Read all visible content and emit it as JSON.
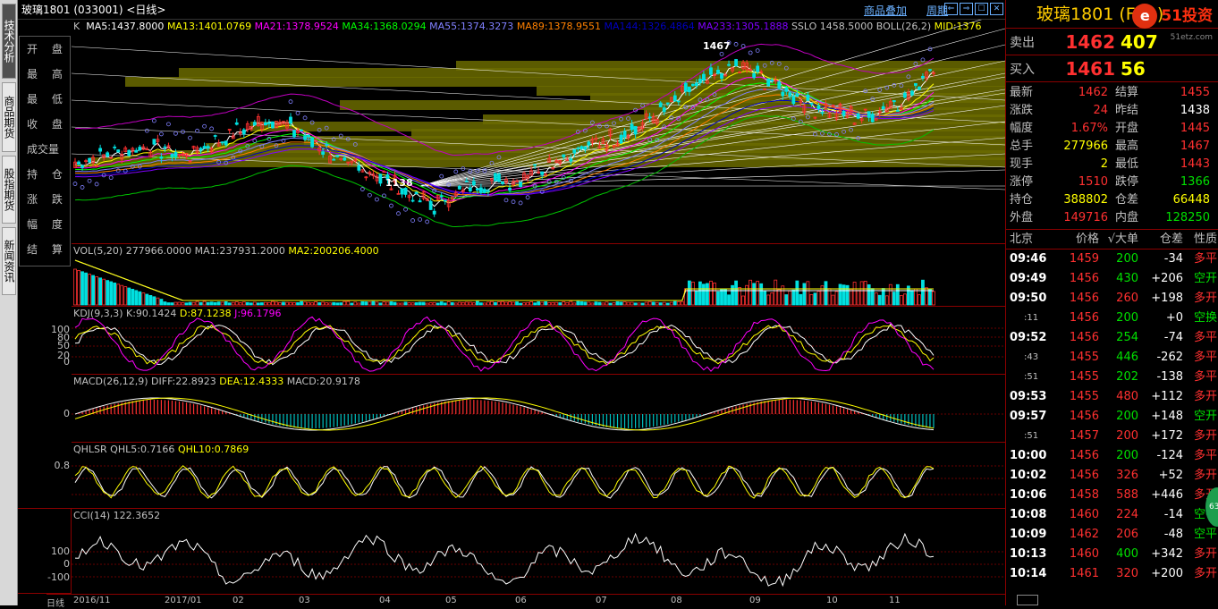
{
  "window": {
    "title": "玻璃1801 (033001) <日线>",
    "link1": "商品叠加",
    "link2": "周期",
    "nav1": "⇐",
    "nav2": "⇒",
    "nav3": "☐",
    "nav4": "✕"
  },
  "lefttabs": [
    "技术分析",
    "商品期货",
    "股指期货",
    "新闻资讯"
  ],
  "infopanel": [
    "开 盘",
    "最 高",
    "最 低",
    "收 盘",
    "成交量",
    "持 仓",
    "涨 跌",
    "幅 度",
    "结 算"
  ],
  "kpanel": {
    "label_k": "K",
    "ma5": "MA5:1437.8000",
    "ma13": "MA13:1401.0769",
    "ma21": "MA21:1378.9524",
    "ma34": "MA34:1368.0294",
    "ma55": "MA55:1374.3273",
    "ma89": "MA89:1378.9551",
    "ma144": "MA144:1326.4864",
    "ma233": "MA233:1305.1888",
    "sslo": "SSLO 1458.5000",
    "boll": "BOLL(26,2)",
    "mid": "MID:1376",
    "high_mark": "1467",
    "low_mark": "1138"
  },
  "volpanel": {
    "label": "VOL(5,20) 277966.0000",
    "ma1": "MA1:237931.2000",
    "ma2": "MA2:200206.4000"
  },
  "kdjpanel": {
    "label": "KDJ(9,3,3) K:90.1424",
    "d": "D:87.1238",
    "j": "J:96.1796",
    "ticks": [
      "100",
      "80",
      "50",
      "20",
      "0"
    ]
  },
  "macdpanel": {
    "label": "MACD(26,12,9) DIFF:22.8923",
    "dea": "DEA:12.4333",
    "macd": "MACD:20.9178",
    "tick": "0"
  },
  "qhlpanel": {
    "label": "QHLSR QHL5:0.7166",
    "qhl10": "QHL10:0.7869",
    "tick": "0.8"
  },
  "ccipanel": {
    "label": "CCI(14) 122.3652",
    "ticks": [
      "100",
      "0",
      "-100"
    ]
  },
  "xaxis": [
    "日线",
    "2016/11",
    "2017/01",
    "02",
    "03",
    "04",
    "05",
    "06",
    "07",
    "08",
    "09",
    "10",
    "11"
  ],
  "right": {
    "title": "玻璃1801 (F",
    "title_tail": "01)",
    "logo_text": "51投资",
    "logo_sub": "51etz.com",
    "logo_char": "e",
    "sell_label": "卖出",
    "sell_price": "1462",
    "sell_vol": "407",
    "buy_label": "买入",
    "buy_price": "1461",
    "buy_vol": "56",
    "stats": [
      {
        "l1": "最新",
        "v1": "1462",
        "c1": "red",
        "l2": "结算",
        "v2": "1455",
        "c2": "red"
      },
      {
        "l1": "涨跌",
        "v1": "24",
        "c1": "red",
        "l2": "昨结",
        "v2": "1438",
        "c2": "white"
      },
      {
        "l1": "幅度",
        "v1": "1.67%",
        "c1": "red",
        "l2": "开盘",
        "v2": "1445",
        "c2": "red"
      },
      {
        "l1": "总手",
        "v1": "277966",
        "c1": "yellow",
        "l2": "最高",
        "v2": "1467",
        "c2": "red"
      },
      {
        "l1": "现手",
        "v1": "2",
        "c1": "yellow",
        "l2": "最低",
        "v2": "1443",
        "c2": "red"
      },
      {
        "l1": "涨停",
        "v1": "1510",
        "c1": "red",
        "l2": "跌停",
        "v2": "1366",
        "c2": "green"
      },
      {
        "l1": "持仓",
        "v1": "388802",
        "c1": "yellow",
        "l2": "仓差",
        "v2": "66448",
        "c2": "yellow"
      },
      {
        "l1": "外盘",
        "v1": "149716",
        "c1": "red",
        "l2": "内盘",
        "v2": "128250",
        "c2": "green"
      }
    ],
    "tick_headers": [
      "北京",
      "价格",
      "√大单",
      "仓差",
      "性质"
    ],
    "ticks": [
      {
        "time": "09:46",
        "price": "1459",
        "vol": "200",
        "vc": "green",
        "diff": "-34",
        "nature": "多平",
        "nc": "red"
      },
      {
        "time": "09:49",
        "price": "1456",
        "vol": "430",
        "vc": "green",
        "diff": "+206",
        "nature": "空开",
        "nc": "green"
      },
      {
        "time": "09:50",
        "price": "1456",
        "vol": "260",
        "vc": "red",
        "diff": "+198",
        "nature": "多开",
        "nc": "red"
      },
      {
        "time": ":11",
        "price": "1456",
        "vol": "200",
        "vc": "green",
        "diff": "+0",
        "nature": "空换",
        "nc": "green"
      },
      {
        "time": "09:52",
        "price": "1456",
        "vol": "254",
        "vc": "green",
        "diff": "-74",
        "nature": "多平",
        "nc": "red"
      },
      {
        "time": ":43",
        "price": "1455",
        "vol": "446",
        "vc": "green",
        "diff": "-262",
        "nature": "多平",
        "nc": "red"
      },
      {
        "time": ":51",
        "price": "1455",
        "vol": "202",
        "vc": "green",
        "diff": "-138",
        "nature": "多平",
        "nc": "red"
      },
      {
        "time": "09:53",
        "price": "1455",
        "vol": "480",
        "vc": "red",
        "diff": "+112",
        "nature": "多开",
        "nc": "red"
      },
      {
        "time": "09:57",
        "price": "1456",
        "vol": "200",
        "vc": "green",
        "diff": "+148",
        "nature": "空开",
        "nc": "green"
      },
      {
        "time": ":51",
        "price": "1457",
        "vol": "200",
        "vc": "red",
        "diff": "+172",
        "nature": "多开",
        "nc": "red"
      },
      {
        "time": "10:00",
        "price": "1456",
        "vol": "200",
        "vc": "green",
        "diff": "-124",
        "nature": "多平",
        "nc": "red"
      },
      {
        "time": "10:02",
        "price": "1456",
        "vol": "326",
        "vc": "red",
        "diff": "+52",
        "nature": "多开",
        "nc": "red"
      },
      {
        "time": "10:06",
        "price": "1458",
        "vol": "588",
        "vc": "red",
        "diff": "+446",
        "nature": "多开",
        "nc": "red"
      },
      {
        "time": "10:08",
        "price": "1460",
        "vol": "224",
        "vc": "red",
        "diff": "-14",
        "nature": "空平",
        "nc": "green"
      },
      {
        "time": "10:09",
        "price": "1462",
        "vol": "206",
        "vc": "red",
        "diff": "-48",
        "nature": "空平",
        "nc": "green"
      },
      {
        "time": "10:13",
        "price": "1460",
        "vol": "400",
        "vc": "green",
        "diff": "+342",
        "nature": "多开",
        "nc": "red"
      },
      {
        "time": "10:14",
        "price": "1461",
        "vol": "320",
        "vc": "red",
        "diff": "+200",
        "nature": "多开",
        "nc": "red"
      }
    ]
  }
}
